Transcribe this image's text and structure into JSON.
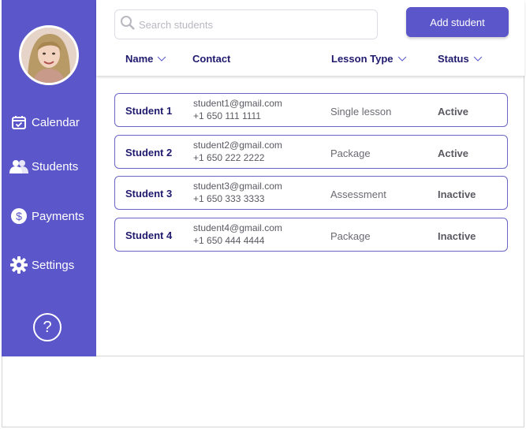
{
  "colors": {
    "accent": "#5b56c9",
    "heading": "#1f1a6e"
  },
  "sidebar": {
    "avatar_icon": "user-avatar",
    "items": [
      {
        "label": "Calendar",
        "icon": "calendar-icon"
      },
      {
        "label": "Students",
        "icon": "users-icon"
      },
      {
        "label": "Payments",
        "icon": "dollar-icon"
      },
      {
        "label": "Settings",
        "icon": "gear-icon"
      }
    ],
    "help": "?"
  },
  "header": {
    "search": {
      "placeholder": "Search students",
      "value": ""
    },
    "add_button": "Add student",
    "columns": {
      "name": "Name",
      "contact": "Contact",
      "lesson_type": "Lesson Type",
      "status": "Status"
    }
  },
  "students": [
    {
      "name": "Student 1",
      "email": "student1@gmail.com",
      "phone": "+1 650 111 1111",
      "lesson": "Single lesson",
      "status": "Active"
    },
    {
      "name": "Student 2",
      "email": "student2@gmail.com",
      "phone": "+1 650 222 2222",
      "lesson": "Package",
      "status": "Active"
    },
    {
      "name": "Student 3",
      "email": "student3@gmail.com",
      "phone": "+1 650 333 3333",
      "lesson": "Assessment",
      "status": "Inactive"
    },
    {
      "name": "Student 4",
      "email": "student4@gmail.com",
      "phone": "+1 650 444 4444",
      "lesson": "Package",
      "status": "Inactive"
    }
  ]
}
